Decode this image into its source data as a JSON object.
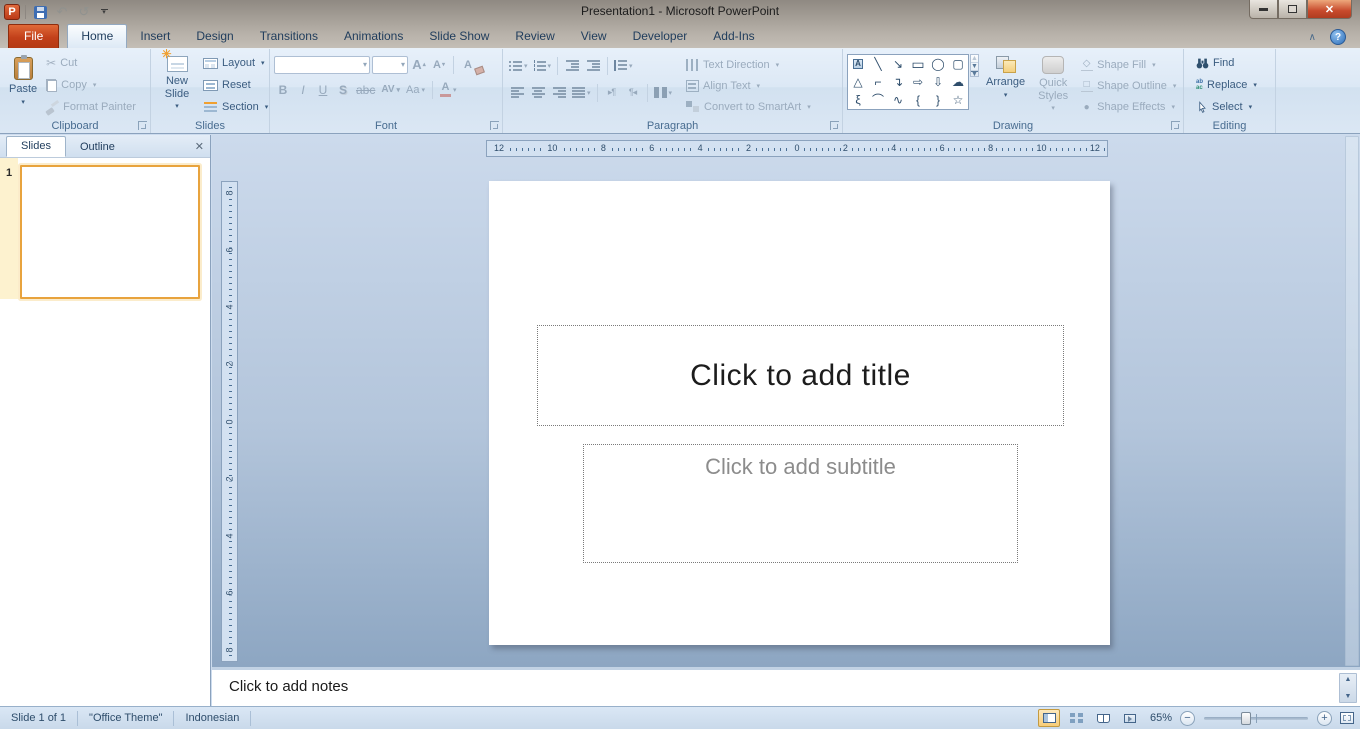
{
  "titlebar": {
    "title": "Presentation1  -  Microsoft PowerPoint"
  },
  "qat": {
    "logo_letter": "P"
  },
  "tabs": [
    "File",
    "Home",
    "Insert",
    "Design",
    "Transitions",
    "Animations",
    "Slide Show",
    "Review",
    "View",
    "Developer",
    "Add-Ins"
  ],
  "ribbon": {
    "clipboard": {
      "group_label": "Clipboard",
      "paste": "Paste",
      "cut": "Cut",
      "copy": "Copy",
      "format_painter": "Format Painter"
    },
    "slides": {
      "group_label": "Slides",
      "new_slide": "New Slide",
      "layout": "Layout",
      "reset": "Reset",
      "section": "Section"
    },
    "font": {
      "group_label": "Font",
      "bold": "B",
      "italic": "I",
      "underline": "U",
      "shadow": "S",
      "strikethrough": "abc",
      "spacing": "AV",
      "case": "Aa",
      "color": "A",
      "grow": "A",
      "shrink": "A",
      "clear": "A"
    },
    "paragraph": {
      "group_label": "Paragraph",
      "text_direction": "Text Direction",
      "align_text": "Align Text",
      "convert_smartart": "Convert to SmartArt",
      "ltr": "▸¶",
      "rtl": "¶◂"
    },
    "drawing": {
      "group_label": "Drawing",
      "arrange": "Arrange",
      "quick_styles": "Quick Styles",
      "shape_fill": "Shape Fill",
      "shape_outline": "Shape Outline",
      "shape_effects": "Shape Effects",
      "shape_glyphs": [
        "A",
        "╲",
        "↘",
        "▭",
        "◯",
        "▢",
        "△",
        "⌐",
        "↴",
        "⇨",
        "⇩",
        "☁",
        "ξ",
        "⌒",
        "∿",
        "{",
        "}",
        "☆"
      ]
    },
    "editing": {
      "group_label": "Editing",
      "find": "Find",
      "replace": "Replace",
      "select": "Select"
    }
  },
  "panel": {
    "tabs": [
      "Slides",
      "Outline"
    ],
    "slide_number": "1"
  },
  "rulers": {
    "h": [
      "12",
      "10",
      "8",
      "6",
      "4",
      "2",
      "0",
      "2",
      "4",
      "6",
      "8",
      "10",
      "12"
    ],
    "v": [
      "8",
      "6",
      "4",
      "2",
      "0",
      "2",
      "4",
      "6",
      "8"
    ]
  },
  "slide": {
    "title_placeholder": "Click to add title",
    "subtitle_placeholder": "Click to add subtitle"
  },
  "notes": {
    "placeholder": "Click to add notes"
  },
  "statusbar": {
    "slide_info": "Slide 1 of 1",
    "theme": "\"Office Theme\"",
    "language": "Indonesian",
    "zoom_level": "65%"
  }
}
